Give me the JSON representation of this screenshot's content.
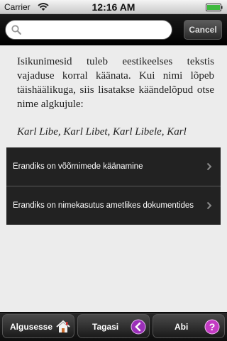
{
  "status_bar": {
    "carrier": "Carrier",
    "time": "12:16 AM"
  },
  "search": {
    "value": "",
    "placeholder": "",
    "cancel_label": "Cancel"
  },
  "content": {
    "paragraph": "Isikunimesid tuleb eestikeelses tekstis vajaduse korral käänata. Kui nimi lõpeb täishäälikuga, siis lisatakse käändelõpud otse nime algkujule:",
    "example": "Karl Libe, Karl Libet, Karl Libele, Karl",
    "links": [
      {
        "label": "Erandiks on võõrnimede käänamine"
      },
      {
        "label": "Erandiks on  nimekasutus ametlikes dokumentides"
      }
    ]
  },
  "toolbar": {
    "home_label": "Algusesse",
    "back_label": "Tagasi",
    "help_label": "Abi"
  },
  "colors": {
    "list_background": "#222222",
    "back_icon": "#9b2fb8",
    "help_icon": "#c43bc4"
  },
  "icons": [
    "wifi-icon",
    "battery-icon",
    "search-icon",
    "chevron-right-icon",
    "home-icon",
    "back-arrow-icon",
    "help-icon"
  ]
}
